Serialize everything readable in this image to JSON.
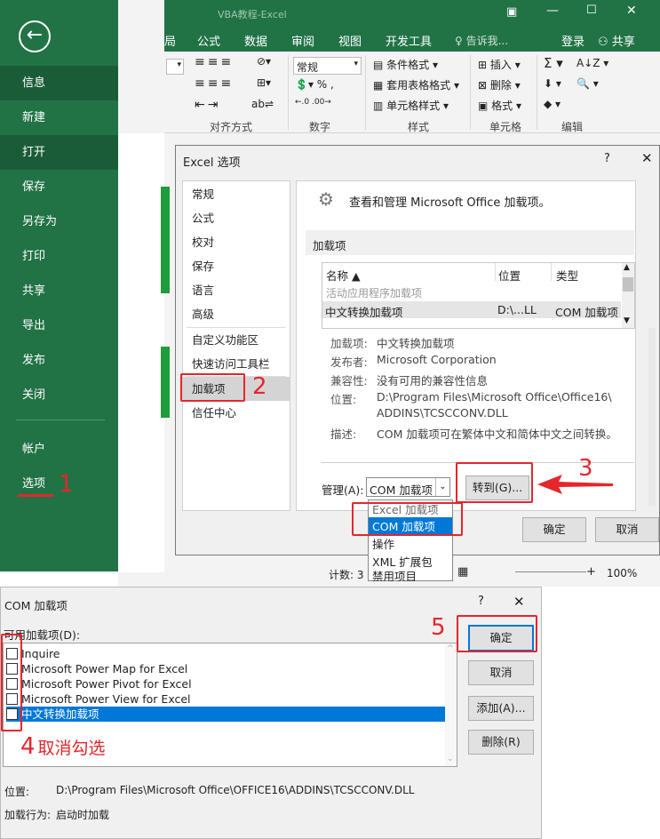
{
  "backstage": {
    "items": [
      "信息",
      "新建",
      "打开",
      "保存",
      "另存为",
      "打印",
      "共享",
      "导出",
      "发布",
      "关闭",
      "帐户",
      "选项"
    ]
  },
  "excel": {
    "window_title": "VBA教程-Excel",
    "menu": [
      "局",
      "公式",
      "数据",
      "审阅",
      "视图",
      "开发工具",
      "告诉我...",
      "登录",
      "共享"
    ],
    "ribbon": {
      "font_name": "常规",
      "conditional_format": "条件格式",
      "table_format": "套用表格格式",
      "cell_style": "单元格样式",
      "insert": "插入",
      "delete": "删除",
      "format": "格式",
      "group_align": "对齐方式",
      "group_number": "数字",
      "group_style": "样式",
      "group_cells": "单元格",
      "group_edit": "编辑"
    },
    "status_count": "计数: 3",
    "zoom": "100%"
  },
  "options_dialog": {
    "title": "Excel 选项",
    "help": "?",
    "nav": [
      "常规",
      "公式",
      "校对",
      "保存",
      "语言",
      "高级",
      "自定义功能区",
      "快速访问工具栏",
      "加载项",
      "信任中心"
    ],
    "header_text": "查看和管理 Microsoft Office 加载项。",
    "section": "加载项",
    "table_headers": [
      "名称 ▲",
      "位置",
      "类型"
    ],
    "group_label": "活动应用程序加载项",
    "row": {
      "name": "中文转换加载项",
      "location": "D:\\...LL",
      "type": "COM 加载项"
    },
    "info": [
      {
        "label": "加载项:",
        "value": "中文转换加载项"
      },
      {
        "label": "发布者:",
        "value": "Microsoft Corporation"
      },
      {
        "label": "兼容性:",
        "value": "没有可用的兼容性信息"
      },
      {
        "label": "位置:",
        "value": "D:\\Program Files\\Microsoft Office\\Office16\\"
      },
      {
        "label": "",
        "value": "ADDINS\\TCSCCONV.DLL"
      },
      {
        "label": "描述:",
        "value": "COM 加载项可在繁体中文和简体中文之间转换。"
      }
    ],
    "manage_label": "管理(A):",
    "manage_value": "COM 加载项",
    "go_button": "转到(G)...",
    "ok": "确定",
    "cancel": "取消",
    "dropdown_options": [
      "Excel 加载项",
      "COM 加载项",
      "操作",
      "XML 扩展包",
      "禁用项目"
    ]
  },
  "com_dialog": {
    "title": "COM 加载项",
    "help": "?",
    "list_label": "可用加载项(D):",
    "items": [
      "Inquire",
      "Microsoft Power Map for Excel",
      "Microsoft Power Pivot for Excel",
      "Microsoft Power View for Excel",
      "中文转换加载项"
    ],
    "ok": "确定",
    "cancel": "取消",
    "add": "添加(A)...",
    "remove": "删除(R)",
    "location_label": "位置:",
    "location_value": "D:\\Program Files\\Microsoft Office\\OFFICE16\\ADDINS\\TCSCCONV.DLL",
    "behavior_label": "加载行为:",
    "behavior_value": "启动时加载"
  },
  "annotations": {
    "step1": "1",
    "step2": "2",
    "step3": "3",
    "step4": "4",
    "step4_text": "取消勾选",
    "step5": "5"
  },
  "colors": {
    "excel_green": "#217346",
    "selection_blue": "#0078d7",
    "annotation_red": "#e5262b"
  }
}
